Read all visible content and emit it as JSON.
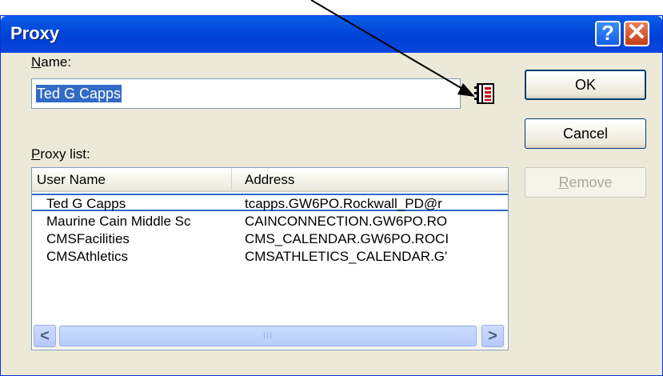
{
  "window": {
    "title": "Proxy",
    "help_label": "?",
    "close_label": "✕"
  },
  "name_field": {
    "label_underlined": "N",
    "label_rest": "ame:",
    "value": "Ted G Capps"
  },
  "address_book_icon": "address-book-icon",
  "proxy_list": {
    "label_underlined": "P",
    "label_rest": "roxy list:",
    "columns": [
      "User Name",
      "Address"
    ],
    "rows": [
      {
        "user": "Ted G Capps",
        "address": "tcapps.GW6PO.Rockwall_PD@r"
      },
      {
        "user": "Maurine Cain Middle Sc",
        "address": "CAINCONNECTION.GW6PO.RO"
      },
      {
        "user": "CMSFacilities",
        "address": "CMS_CALENDAR.GW6PO.ROCI"
      },
      {
        "user": "CMSAthletics",
        "address": "CMSATHLETICS_CALENDAR.G'"
      }
    ],
    "scroll_left": "<",
    "scroll_right": ">",
    "thumb_grip": "III"
  },
  "buttons": {
    "ok": "OK",
    "cancel": "Cancel",
    "remove_underlined": "R",
    "remove_rest": "emove"
  },
  "colors": {
    "title_bar": "#0a5ef0",
    "selection": "#316ac5",
    "dialog_bg": "#ece9d8"
  }
}
